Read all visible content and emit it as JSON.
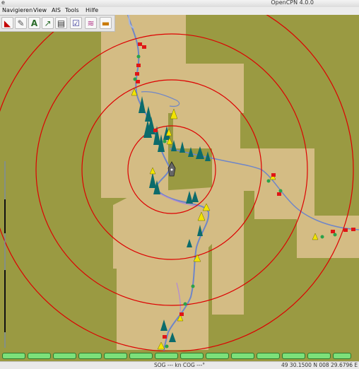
{
  "window": {
    "title": "OpenCPN 4.0.0",
    "controls": "e"
  },
  "menu": {
    "items": [
      "Navigieren",
      "View",
      "AIS",
      "Tools",
      "Hilfe"
    ]
  },
  "toolbar": {
    "buttons": [
      {
        "icon": "ruler-icon"
      },
      {
        "icon": "pen-icon"
      },
      {
        "icon": "text-icon"
      },
      {
        "icon": "route-icon"
      },
      {
        "icon": "print-icon"
      },
      {
        "icon": "route-manager-icon"
      },
      {
        "icon": "settings-icon"
      },
      {
        "icon": "tide-icon"
      }
    ]
  },
  "status": {
    "sog": "SOG --- kn  COG ---°",
    "position": "49 30.1500 N   008 29.6796 E"
  },
  "colors": {
    "land": "#9a9a42",
    "shallow": "#d4bc84",
    "river": "#6f86c8",
    "range_ring": "#dd0000",
    "buoy_green": "#0c6b6b",
    "buoy_yellow": "#f2e400",
    "buoy_red": "#e01515",
    "piano_key": "#7ce07a"
  }
}
